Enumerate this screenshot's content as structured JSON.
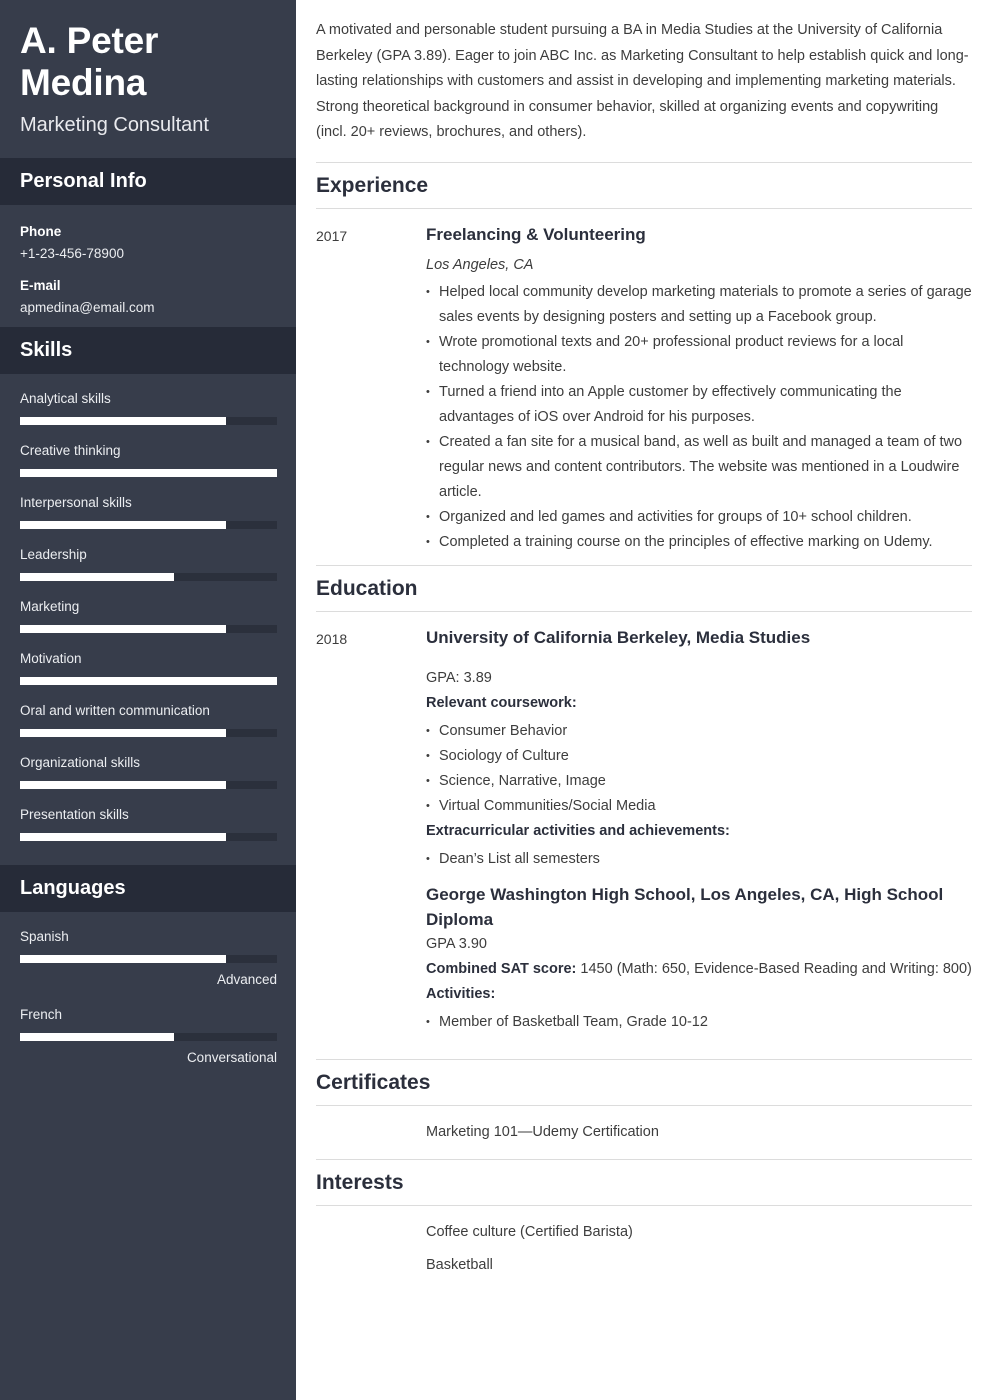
{
  "sidebar": {
    "name": "A. Peter Medina",
    "job_title": "Marketing Consultant",
    "personal_info": {
      "heading": "Personal Info",
      "phone_label": "Phone",
      "phone_value": "+1-23-456-78900",
      "email_label": "E-mail",
      "email_value": "apmedina@email.com"
    },
    "skills": {
      "heading": "Skills",
      "items": [
        {
          "label": "Analytical skills",
          "level": 80
        },
        {
          "label": "Creative thinking",
          "level": 100
        },
        {
          "label": "Interpersonal skills",
          "level": 80
        },
        {
          "label": "Leadership",
          "level": 60
        },
        {
          "label": "Marketing",
          "level": 80
        },
        {
          "label": "Motivation",
          "level": 100
        },
        {
          "label": "Oral and written communication",
          "level": 80
        },
        {
          "label": "Organizational skills",
          "level": 80
        },
        {
          "label": "Presentation skills",
          "level": 80
        }
      ]
    },
    "languages": {
      "heading": "Languages",
      "items": [
        {
          "label": "Spanish",
          "level": 80,
          "proficiency": "Advanced"
        },
        {
          "label": "French",
          "level": 60,
          "proficiency": "Conversational"
        }
      ]
    }
  },
  "main": {
    "summary": "A motivated and personable student pursuing a BA in Media Studies at the University of California Berkeley (GPA 3.89). Eager to join ABC Inc. as Marketing Consultant to help establish quick and long-lasting relationships with customers and assist in developing and implementing marketing materials. Strong theoretical background in consumer behavior, skilled at organizing events and copywriting (incl. 20+ reviews, brochures, and others).",
    "experience": {
      "heading": "Experience",
      "date": "2017",
      "title": "Freelancing & Volunteering",
      "location": "Los Angeles, CA",
      "bullets": [
        "Helped local community develop marketing materials to promote a series of garage sales events by designing posters and setting up a Facebook group.",
        "Wrote promotional texts and 20+ professional product reviews for a local technology website.",
        "Turned a friend into an Apple customer by effectively communicating the advantages of iOS over Android for his purposes.",
        "Created a fan site for a musical band, as well as built and managed a team of two regular news and content contributors. The website was mentioned in a Loudwire article.",
        "Organized and led games and activities for groups of 10+ school children.",
        "Completed a training course on the principles of effective marking on Udemy."
      ]
    },
    "education": {
      "heading": "Education",
      "university": {
        "date": "2018",
        "title": "University of California Berkeley, Media Studies",
        "gpa": "GPA: 3.89",
        "coursework_label": "Relevant coursework:",
        "coursework": [
          "Consumer Behavior",
          "Sociology of Culture",
          "Science, Narrative, Image",
          "Virtual Communities/Social Media"
        ],
        "extracurricular_label": "Extracurricular activities and achievements:",
        "extracurricular": [
          "Dean’s List all semesters"
        ]
      },
      "highschool": {
        "title": "George Washington High School, Los Angeles, CA, High School Diploma",
        "gpa": "GPA 3.90",
        "sat_label": "Combined SAT score:",
        "sat_value": " 1450 (Math: 650, Evidence-Based Reading and Writing: 800)",
        "activities_label": "Activities:",
        "activities": [
          "Member of Basketball Team, Grade 10-12"
        ]
      }
    },
    "certificates": {
      "heading": "Certificates",
      "items": [
        "Marketing 101—Udemy Certification"
      ]
    },
    "interests": {
      "heading": "Interests",
      "items": [
        "Coffee culture (Certified Barista)",
        "Basketball"
      ]
    }
  },
  "theme": {
    "sidebar_bg": "#373d4b",
    "sidebar_header_bg": "#262b38",
    "bar_fill": "#ffffff",
    "bar_track": "#2b303c",
    "heading_color": "#2b2f3c",
    "body_color": "#3d3d3d",
    "rule_color": "#dcdcdc"
  }
}
